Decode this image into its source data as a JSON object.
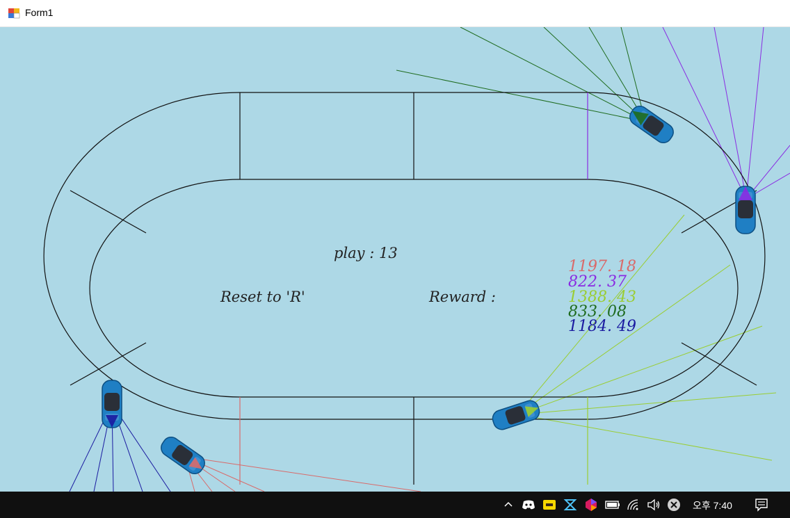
{
  "window": {
    "title": "Form1"
  },
  "hud": {
    "play_label": "play : 13",
    "reset_hint": "Reset to 'R'",
    "reward_label": "Reward :"
  },
  "rewards": [
    {
      "value": "1197. 18",
      "color": "#D96A6A"
    },
    {
      "value": "822. 37",
      "color": "#8A2BE2"
    },
    {
      "value": "1388. 43",
      "color": "#9ACD32"
    },
    {
      "value": "833. 08",
      "color": "#1E6B1E"
    },
    {
      "value": "1184. 49",
      "color": "#1A1AA0"
    }
  ],
  "cars": [
    {
      "name": "car-red",
      "sensor_color": "#D96A6A"
    },
    {
      "name": "car-purple",
      "sensor_color": "#8A2BE2"
    },
    {
      "name": "car-lime",
      "sensor_color": "#9ACD32"
    },
    {
      "name": "car-green",
      "sensor_color": "#1E6B1E"
    },
    {
      "name": "car-blue",
      "sensor_color": "#1A1AA0"
    }
  ],
  "taskbar": {
    "tray_icons": [
      "chevron-up-icon",
      "discord-icon",
      "kakaotalk-icon",
      "app-icon-1",
      "app-icon-2",
      "battery-icon",
      "wifi-icon",
      "volume-icon",
      "close-circle-icon"
    ],
    "clock": "오후 7:40",
    "notification_icon": "notification-icon"
  }
}
